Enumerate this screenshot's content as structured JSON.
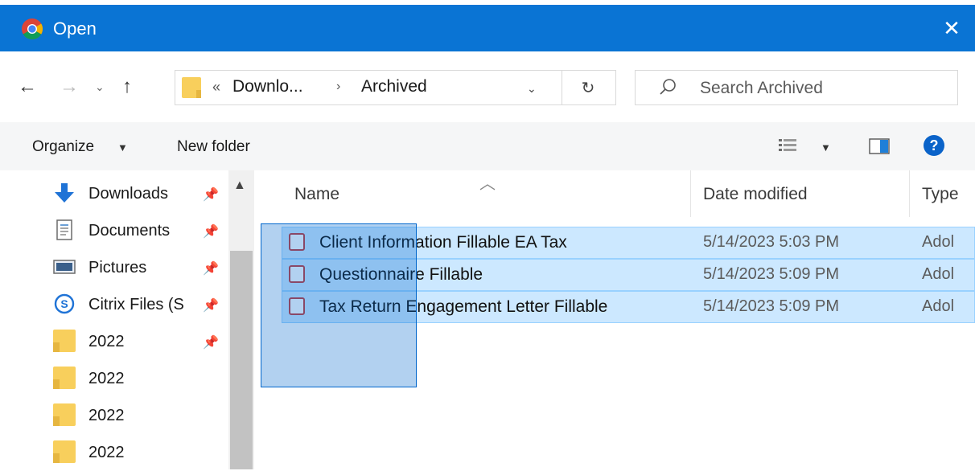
{
  "window": {
    "title": "Open",
    "close_label": "✕"
  },
  "address": {
    "overflow": "«",
    "crumbs": [
      "Downlo...",
      "Archived"
    ],
    "separator": "›"
  },
  "search": {
    "placeholder": "Search Archived"
  },
  "toolbar": {
    "organize_label": "Organize",
    "new_folder_label": "New folder",
    "help_label": "?"
  },
  "nav_pane": {
    "items": [
      {
        "label": "Downloads",
        "icon": "download-arrow-icon",
        "pinned": true
      },
      {
        "label": "Documents",
        "icon": "documents-icon",
        "pinned": true
      },
      {
        "label": "Pictures",
        "icon": "pictures-icon",
        "pinned": true
      },
      {
        "label": "Citrix Files (S",
        "icon": "citrix-icon",
        "pinned": true
      },
      {
        "label": "2022",
        "icon": "folder-icon",
        "pinned": true
      },
      {
        "label": "2022",
        "icon": "folder-icon",
        "pinned": false
      },
      {
        "label": "2022",
        "icon": "folder-icon",
        "pinned": false
      },
      {
        "label": "2022",
        "icon": "folder-icon",
        "pinned": false
      }
    ]
  },
  "file_list": {
    "columns": [
      "Name",
      "Date modified",
      "Type"
    ],
    "rows": [
      {
        "name": "Client Information Fillable EA Tax",
        "date": "5/14/2023 5:03 PM",
        "type": "Adol"
      },
      {
        "name": "Questionnaire Fillable",
        "date": "5/14/2023 5:09 PM",
        "type": "Adol"
      },
      {
        "name": "Tax Return Engagement Letter Fillable",
        "date": "5/14/2023 5:09 PM",
        "type": "Adol"
      }
    ]
  },
  "colors": {
    "titlebar": "#0a74d4",
    "selection": "#cce8ff",
    "folder": "#f8cf5c"
  }
}
